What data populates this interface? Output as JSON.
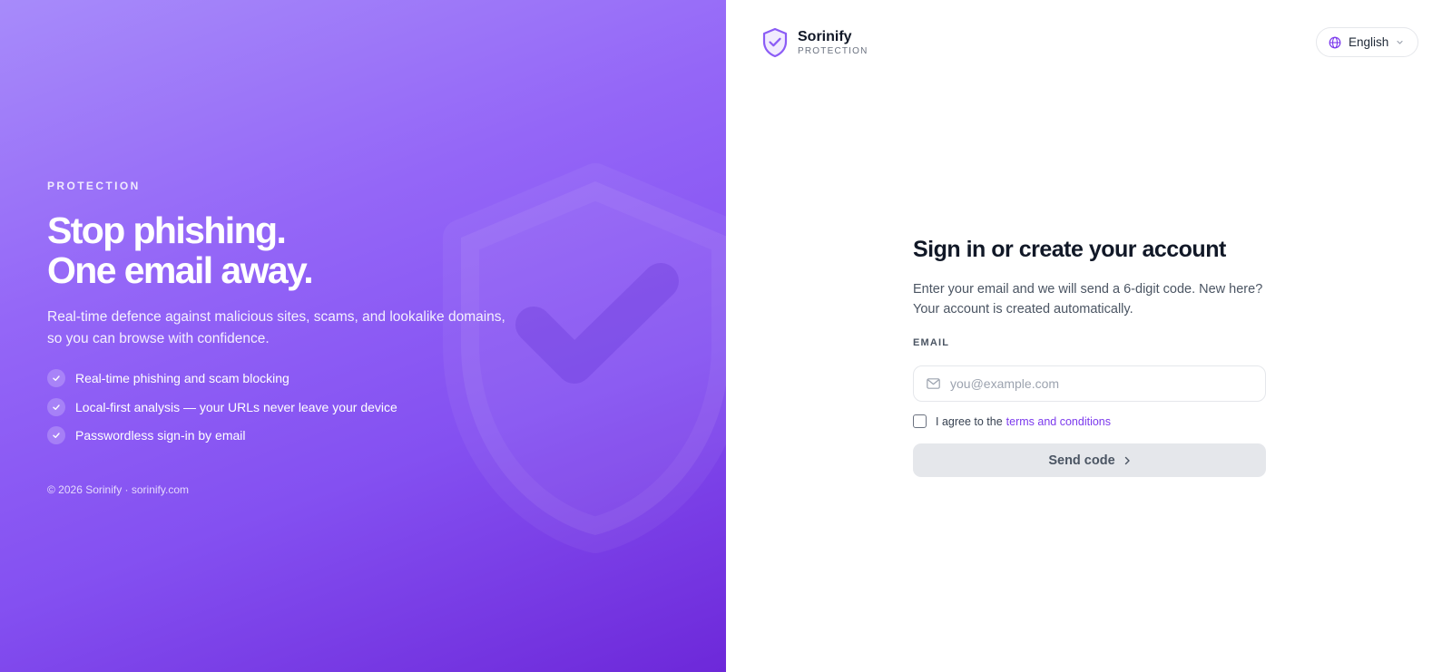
{
  "hero": {
    "eyebrow": "PROTECTION",
    "headline_line1": "Stop phishing.",
    "headline_line2": "One email away.",
    "subtext": "Real-time defence against malicious sites, scams, and lookalike domains, so you can browse with confidence.",
    "features": [
      "Real-time phishing and scam blocking",
      "Local-first analysis — your URLs never leave your device",
      "Passwordless sign-in by email"
    ],
    "copyright": "© 2026 Sorinify · sorinify.com"
  },
  "brand": {
    "name": "Sorinify",
    "tagline": "PROTECTION"
  },
  "language": {
    "selected": "English",
    "icon": "globe-icon"
  },
  "form": {
    "title": "Sign in or create your account",
    "description": "Enter your email and we will send a 6-digit code. New here? Your account is created automatically.",
    "email_label": "EMAIL",
    "email_placeholder": "you@example.com",
    "email_value": "",
    "agree_prefix": "I agree to the",
    "agree_link": "terms and conditions",
    "agree_checked": false,
    "submit_label": "Send code"
  },
  "colors": {
    "accent": "#7c3aed",
    "hero_gradient_start": "#a78bfa",
    "hero_gradient_end": "#6d28d9",
    "button_disabled_bg": "#e5e7eb"
  }
}
